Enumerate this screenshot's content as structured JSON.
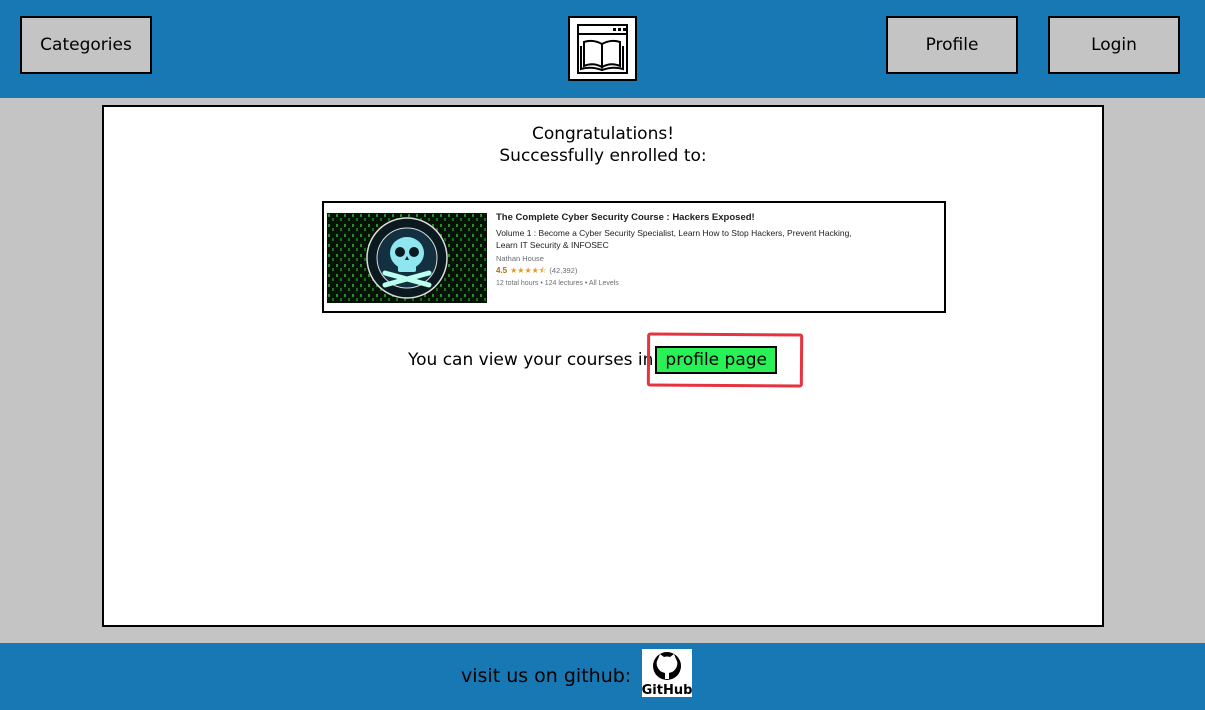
{
  "header": {
    "categories_label": "Categories",
    "profile_label": "Profile",
    "login_label": "Login",
    "logo_icon": "book-icon"
  },
  "main": {
    "congrats_line1": "Congratulations!",
    "congrats_line2": "Successfully enrolled to:",
    "course": {
      "title": "The Complete Cyber Security Course : Hackers Exposed!",
      "subtitle_line1": "Volume 1 : Become a Cyber Security Specialist, Learn How to Stop Hackers, Prevent Hacking,",
      "subtitle_line2": "Learn IT Security & INFOSEC",
      "author": "Nathan House",
      "rating": "4.5",
      "stars": "★★★★⯪",
      "rating_count": "(42,392)",
      "meta": "12 total hours • 124 lectures • All Levels",
      "thumbnail_text": "0110101000 1101010"
    },
    "view_text": "You can view your courses in",
    "profile_link_label": "profile page"
  },
  "footer": {
    "text": "visit us on github:",
    "github_label": "GitHub"
  },
  "colors": {
    "header_bg": "#1878b3",
    "page_bg": "#c4c4c4",
    "button_bg": "#c4c4c4",
    "profile_link_bg": "#29f155",
    "highlight": "#e53440"
  }
}
